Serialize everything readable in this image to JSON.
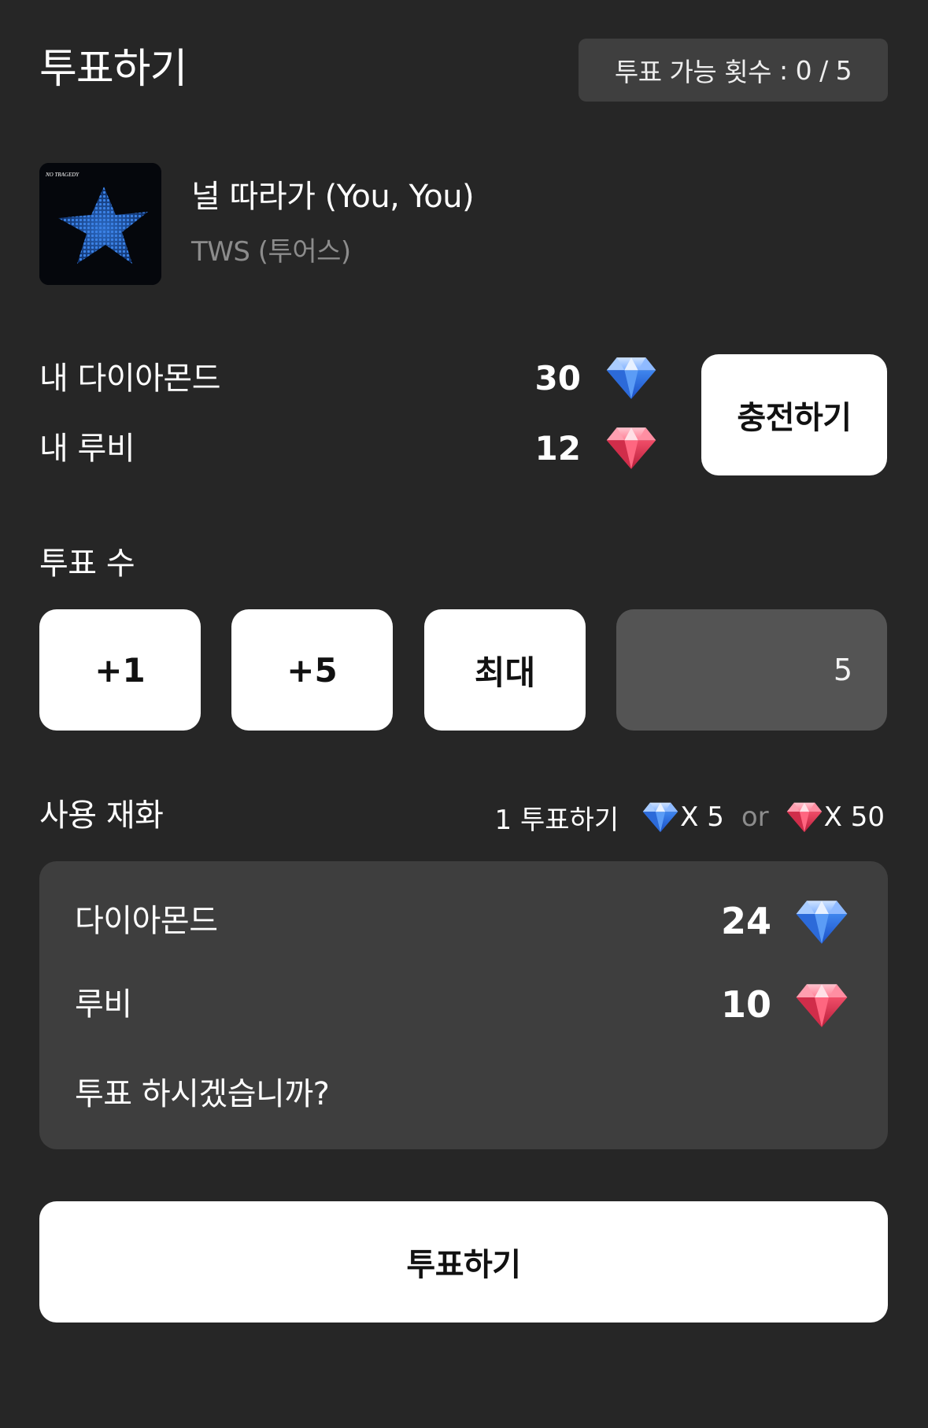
{
  "header": {
    "title": "투표하기",
    "vote_count_label": "투표 가능 횟수",
    "vote_count_value": "0 / 5"
  },
  "song": {
    "title": "널 따라가 (You, You)",
    "artist": "TWS (투어스)",
    "album_art_text": "NO TRAGEDY"
  },
  "wallet": {
    "diamond_label": "내 다이아몬드",
    "diamond_value": "30",
    "ruby_label": "내 루비",
    "ruby_value": "12",
    "charge_button": "충전하기"
  },
  "vote_amount": {
    "label": "투표 수",
    "buttons": [
      "+1",
      "+5",
      "최대"
    ],
    "current_value": "5"
  },
  "cost": {
    "label": "사용 재화",
    "per_vote": "1 투표하기",
    "diamond_cost": "X 5",
    "or_text": "or",
    "ruby_cost": "X 50"
  },
  "summary": {
    "diamond_label": "다이아몬드",
    "diamond_value": "24",
    "ruby_label": "루비",
    "ruby_value": "10",
    "confirm_question": "투표 하시겠습니까?"
  },
  "submit_button": "투표하기",
  "colors": {
    "background": "#262626",
    "panel": "#3e3e3e",
    "input": "#545454",
    "diamond": "#4a8df0",
    "ruby": "#e8455f"
  },
  "icons": {
    "diamond": "diamond-icon",
    "ruby": "ruby-icon"
  }
}
